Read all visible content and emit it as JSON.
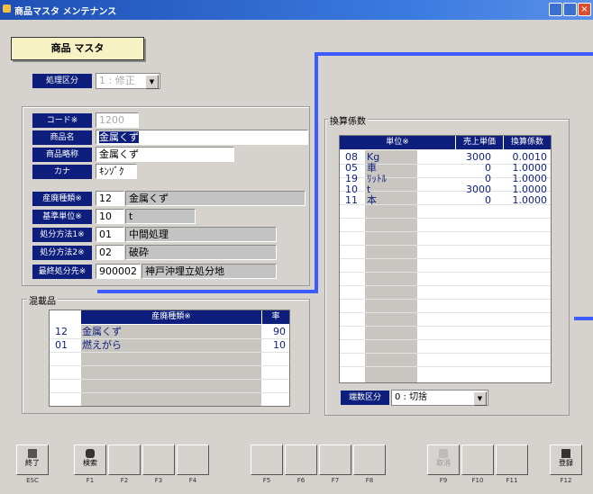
{
  "window": {
    "title": "商品マスタ メンテナンス"
  },
  "header": {
    "title": "商品 マスタ"
  },
  "form": {
    "shori_kubun": {
      "label": "処理区分",
      "value": "1 : 修正"
    },
    "code": {
      "label": "コード※",
      "value": "1200"
    },
    "shohin_mei": {
      "label": "商品名",
      "value": "金属くず"
    },
    "shohin_ryakusho": {
      "label": "商品略称",
      "value": "金属くず"
    },
    "kana": {
      "label": "カナ",
      "value": "ｷﾝｿﾞｸ"
    },
    "sanpai_shurui": {
      "label": "産廃種類※",
      "code": "12",
      "name": "金属くず"
    },
    "kijun_tani": {
      "label": "基準単位※",
      "code": "10",
      "name": "t"
    },
    "shobun_hoho1": {
      "label": "処分方法1※",
      "code": "01",
      "name": "中間処理"
    },
    "shobun_hoho2": {
      "label": "処分方法2※",
      "code": "02",
      "name": "破砕"
    },
    "saishu_shobunsaki": {
      "label": "最終処分先※",
      "code": "900002",
      "name": "神戸沖埋立処分地"
    }
  },
  "mixed": {
    "group_label": "混載品",
    "headers": [
      "産廃種類※",
      "率"
    ],
    "rows": [
      {
        "code": "12",
        "name": "金属くず",
        "rate": "90"
      },
      {
        "code": "01",
        "name": "燃えがら",
        "rate": "10"
      }
    ]
  },
  "conversion": {
    "group_label": "換算係数",
    "headers": [
      "単位※",
      "売上単価",
      "換算係数"
    ],
    "rows": [
      {
        "code": "08",
        "unit": "Kg",
        "price": "3000",
        "factor": "0.0010"
      },
      {
        "code": "05",
        "unit": "車",
        "price": "0",
        "factor": "1.0000"
      },
      {
        "code": "19",
        "unit": "ﾘｯﾄﾙ",
        "price": "0",
        "factor": "1.0000"
      },
      {
        "code": "10",
        "unit": "t",
        "price": "3000",
        "factor": "1.0000"
      },
      {
        "code": "11",
        "unit": "本",
        "price": "0",
        "factor": "1.0000"
      }
    ],
    "rounding": {
      "label": "端数区分",
      "value": "0 : 切捨"
    }
  },
  "fkeys": [
    {
      "caption": "ESC",
      "label": "終了",
      "icon": "exit-icon"
    },
    {
      "caption": "F1",
      "label": "検索",
      "icon": "binoculars-icon"
    },
    {
      "caption": "F2",
      "label": ""
    },
    {
      "caption": "F3",
      "label": ""
    },
    {
      "caption": "F4",
      "label": ""
    },
    {
      "caption": "F5",
      "label": ""
    },
    {
      "caption": "F6",
      "label": ""
    },
    {
      "caption": "F7",
      "label": ""
    },
    {
      "caption": "F8",
      "label": ""
    },
    {
      "caption": "F9",
      "label": "取消",
      "icon": "undo-icon"
    },
    {
      "caption": "F10",
      "label": ""
    },
    {
      "caption": "F11",
      "label": ""
    },
    {
      "caption": "F12",
      "label": "登録",
      "icon": "save-icon"
    }
  ],
  "colors": {
    "accent": "#0d1e7c",
    "title_bar": "#1f4fb5",
    "header_bg": "#f6f2c4",
    "highlight_line": "#3c5cff"
  }
}
